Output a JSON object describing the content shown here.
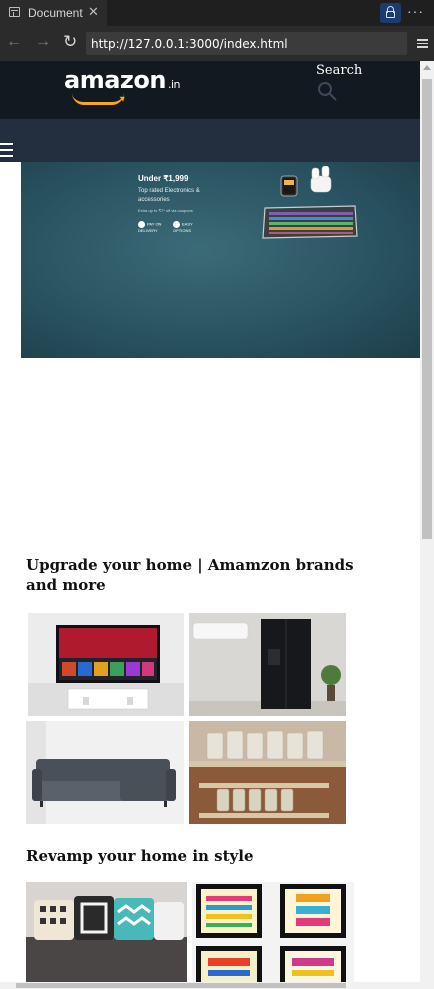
{
  "browser": {
    "tab_title": "Document",
    "tab_close": "✕",
    "url": "http://127.0.0.1:3000/index.html",
    "more": "···",
    "back": "←",
    "forward": "→",
    "reload": "↻"
  },
  "header": {
    "logo_text": "amazon",
    "logo_tld": ".in",
    "search_label": "Search"
  },
  "banner": {
    "title": "Under ₹1,999",
    "subtitle": "Top rated Electronics & accessories",
    "note": "Extra up to ₹7* off via coupons",
    "pay_on_delivery": "PAY ON DELIVERY",
    "easy_emi": "EASY OPTIONS"
  },
  "sections": [
    {
      "title": "Upgrade your home | Amamzon brands and more"
    },
    {
      "title": "Revamp your home in style"
    }
  ],
  "colors": {
    "header_bg": "#131921",
    "subnav_bg": "#232f3e",
    "logo_smile": "#f7a81b"
  }
}
